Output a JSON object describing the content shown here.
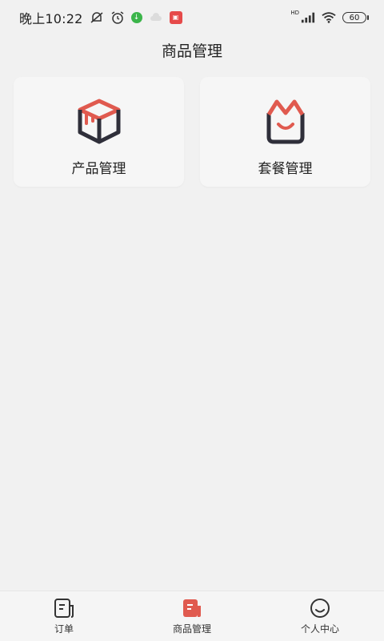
{
  "status_bar": {
    "time": "晚上10:22",
    "battery": "60",
    "hd": "HD"
  },
  "header": {
    "title": "商品管理"
  },
  "cards": [
    {
      "label": "产品管理",
      "icon": "box-icon"
    },
    {
      "label": "套餐管理",
      "icon": "bag-icon"
    }
  ],
  "tabs": [
    {
      "label": "订单",
      "icon": "order-icon",
      "active": false
    },
    {
      "label": "商品管理",
      "icon": "goods-icon",
      "active": true
    },
    {
      "label": "个人中心",
      "icon": "smile-icon",
      "active": false
    }
  ],
  "colors": {
    "accent": "#e05a4f",
    "icon_dark": "#2f2f3a",
    "background": "#f1f1f1"
  }
}
